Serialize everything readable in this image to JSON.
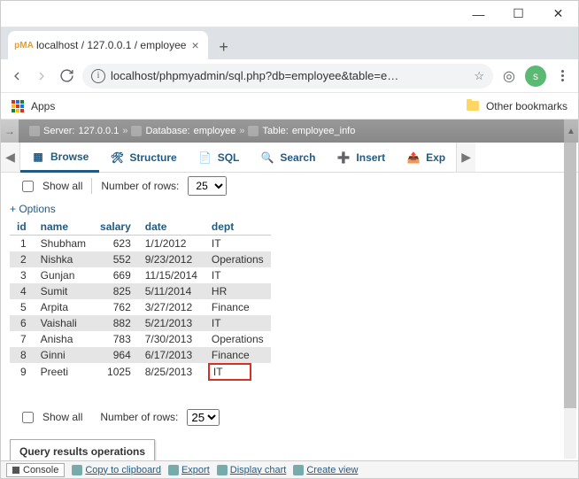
{
  "window": {
    "tab_title": "localhost / 127.0.0.1 / employee",
    "url": "localhost/phpmyadmin/sql.php?db=employee&table=e…"
  },
  "chrome": {
    "apps_label": "Apps",
    "other_bookmarks": "Other bookmarks",
    "avatar_initial": "s"
  },
  "breadcrumb": {
    "server_label": "Server:",
    "server_value": "127.0.0.1",
    "db_label": "Database:",
    "db_value": "employee",
    "table_label": "Table:",
    "table_value": "employee_info"
  },
  "tabs": {
    "browse": "Browse",
    "structure": "Structure",
    "sql": "SQL",
    "search": "Search",
    "insert": "Insert",
    "export": "Exp"
  },
  "controls": {
    "show_all": "Show all",
    "num_rows_label": "Number of rows:",
    "num_rows_value": "25"
  },
  "options_link": "+ Options",
  "columns": [
    "id",
    "name",
    "salary",
    "date",
    "dept"
  ],
  "rows": [
    {
      "id": "1",
      "name": "Shubham",
      "salary": "623",
      "date": "1/1/2012",
      "dept": "IT"
    },
    {
      "id": "2",
      "name": "Nishka",
      "salary": "552",
      "date": "9/23/2012",
      "dept": "Operations"
    },
    {
      "id": "3",
      "name": "Gunjan",
      "salary": "669",
      "date": "11/15/2014",
      "dept": "IT"
    },
    {
      "id": "4",
      "name": "Sumit",
      "salary": "825",
      "date": "5/11/2014",
      "dept": "HR"
    },
    {
      "id": "5",
      "name": "Arpita",
      "salary": "762",
      "date": "3/27/2012",
      "dept": "Finance"
    },
    {
      "id": "6",
      "name": "Vaishali",
      "salary": "882",
      "date": "5/21/2013",
      "dept": "IT"
    },
    {
      "id": "7",
      "name": "Anisha",
      "salary": "783",
      "date": "7/30/2013",
      "dept": "Operations"
    },
    {
      "id": "8",
      "name": "Ginni",
      "salary": "964",
      "date": "6/17/2013",
      "dept": "Finance"
    },
    {
      "id": "9",
      "name": "Preeti",
      "salary": "1025",
      "date": "8/25/2013",
      "dept": "IT"
    }
  ],
  "qro_label": "Query results operations",
  "footer": {
    "console": "Console",
    "copy": "Copy to clipboard",
    "export": "Export",
    "chart": "Display chart",
    "create_view": "Create view"
  }
}
